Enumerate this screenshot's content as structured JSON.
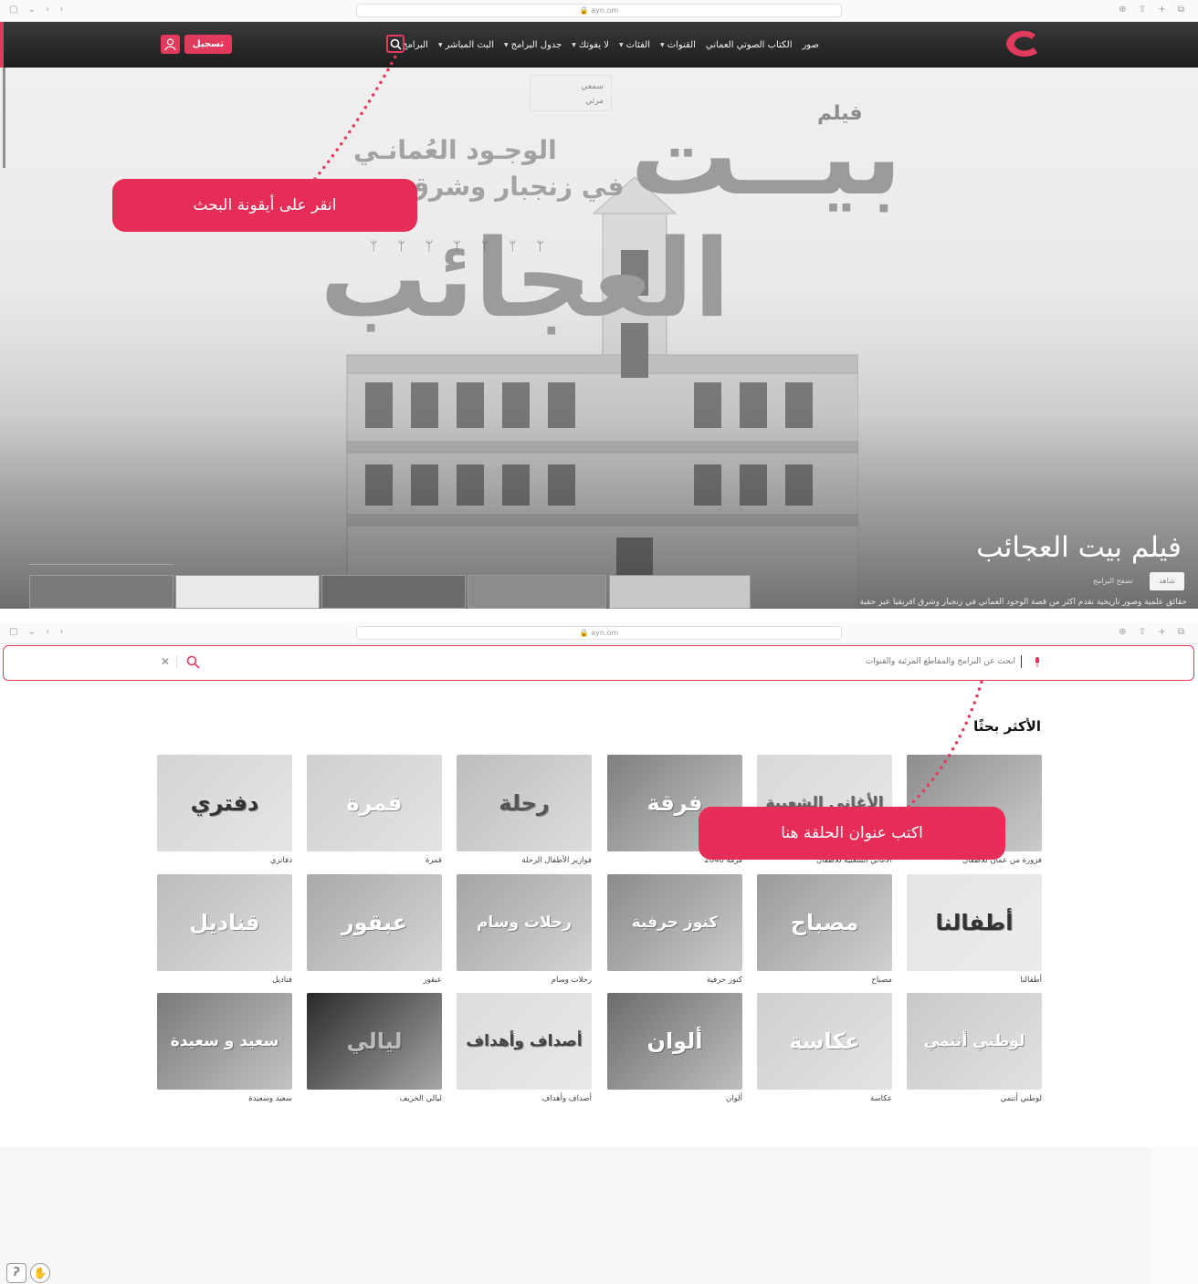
{
  "browser": {
    "url": "ayn.om",
    "left_icons": "▢ ⌄ ‹ ›",
    "right_icons": "⊕ ⇧ + ⧉"
  },
  "navbar": {
    "menu": [
      {
        "label": "البرامج",
        "dropdown": false
      },
      {
        "label": "البث المباشر",
        "dropdown": true
      },
      {
        "label": "جدول البرامج",
        "dropdown": true
      },
      {
        "label": "لا يفوتك",
        "dropdown": true
      },
      {
        "label": "الفئات",
        "dropdown": true
      },
      {
        "label": "القنوات",
        "dropdown": true
      },
      {
        "label": "الكتاب الصوتي العماني",
        "dropdown": false
      },
      {
        "label": "صور",
        "dropdown": false
      }
    ],
    "register_label": "تسجيل",
    "icons": {
      "search": "search-icon",
      "user": "user-icon",
      "logo": "ayn-logo"
    },
    "accent_color": "#e23a5d"
  },
  "dropdown": {
    "items": [
      "سمعي",
      "مرئي"
    ]
  },
  "hero": {
    "artwork": {
      "film": "فيلم",
      "bayt": "بيــت",
      "ajaib": "العجائب",
      "wujud": "الوجـود العُمانـي",
      "zanjibar": "في زنجبار وشرق"
    },
    "title": "فيلم بيت العجائب",
    "watch_button": "شاهد",
    "browse_button": "تصفح البرامج",
    "description": "حقائق علمية وصور تاريخية نقدم أكثر من قصة الوجود العماني في زنجبار وشرق افريقيا عبر حقبة"
  },
  "callouts": {
    "top": "انقر على أيقونة البحث",
    "bottom": "اكتب عنوان الحلقة هنا",
    "color": "#e52d58"
  },
  "search": {
    "placeholder": "ابحث عن البرامج والمقاطع المرئية والقنوات",
    "icons": {
      "mic": "mic-icon",
      "clear": "close-icon",
      "search": "search-icon"
    }
  },
  "most_searched": {
    "title": "الأكثر بحثًا",
    "items": [
      {
        "caption": "فزورة من عمان للأطفال",
        "art": ""
      },
      {
        "caption": "الأغاني الشعبية للأطفال",
        "art": "الأغاني الشعبية"
      },
      {
        "caption": "فرقة 2040",
        "art": "فرقة"
      },
      {
        "caption": "فوازير الأطفال الرحلة",
        "art": "رحلة"
      },
      {
        "caption": "قمرة",
        "art": "قمرة"
      },
      {
        "caption": "دفاتري",
        "art": "دفتري"
      },
      {
        "caption": "أطفالنا",
        "art": "أطفالنا"
      },
      {
        "caption": "مصباح",
        "art": "مصباح"
      },
      {
        "caption": "كنوز حرفية",
        "art": "كنوز حرفية"
      },
      {
        "caption": "رحلات وسام",
        "art": "رحلات وسام"
      },
      {
        "caption": "عبقور",
        "art": "عبقور"
      },
      {
        "caption": "قناديل",
        "art": "قناديل"
      },
      {
        "caption": "لوطني أنتمي",
        "art": "لوطني أنتمي"
      },
      {
        "caption": "عكاسة",
        "art": "عكاسة"
      },
      {
        "caption": "ألوان",
        "art": "ألوان"
      },
      {
        "caption": "أصداف وأهداف",
        "art": "أصداف وأهداف"
      },
      {
        "caption": "ليالي الخريف",
        "art": "ليالي"
      },
      {
        "caption": "سعيد وسعيدة",
        "art": "سعيد و سعيدة"
      }
    ]
  },
  "accessibility": {
    "icons": [
      "hearing-icon",
      "sign-language-icon"
    ]
  }
}
